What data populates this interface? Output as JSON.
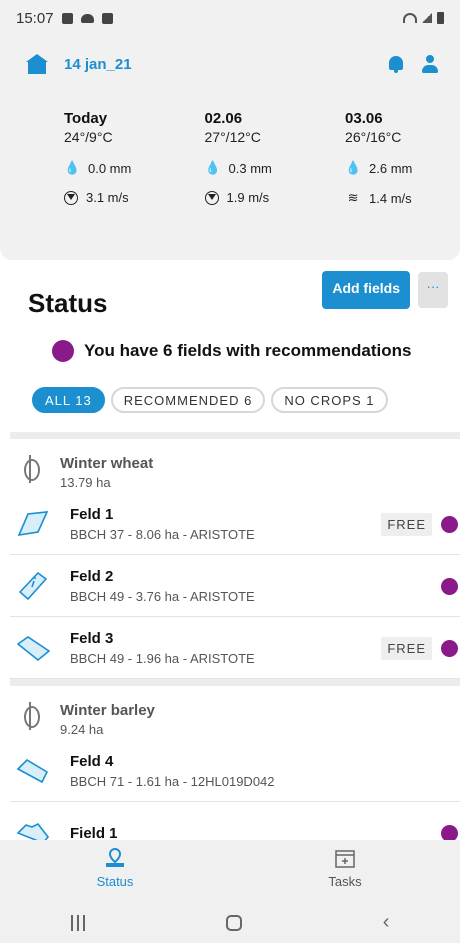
{
  "status_bar": {
    "time": "15:07"
  },
  "header": {
    "farm_name": "14 jan_21"
  },
  "weather": [
    {
      "day": "Today",
      "temp": "24°/9°C",
      "rain": "0.0 mm",
      "wind": "3.1 m/s",
      "wind_icon": "wind-direction-icon"
    },
    {
      "day": "02.06",
      "temp": "27°/12°C",
      "rain": "0.3 mm",
      "wind": "1.9 m/s",
      "wind_icon": "wind-direction-icon"
    },
    {
      "day": "03.06",
      "temp": "26°/16°C",
      "rain": "2.6 mm",
      "wind": "1.4 m/s",
      "wind_icon": "wind-gusts-icon"
    }
  ],
  "status": {
    "title": "Status",
    "add_fields_label": "Add fields",
    "more_label": "···",
    "recommendation_text": "You have 6 fields with recommendations"
  },
  "filters": [
    {
      "label": "ALL 13",
      "active": true
    },
    {
      "label": "RECOMMENDED 6",
      "active": false
    },
    {
      "label": "NO CROPS 1",
      "active": false
    }
  ],
  "groups": [
    {
      "crop": "Winter wheat",
      "area": "13.79 ha",
      "fields": [
        {
          "name": "Feld 1",
          "desc": "BBCH 37 - 8.06 ha - ARISTOTE",
          "badge": "FREE",
          "recommendation": true
        },
        {
          "name": "Feld 2",
          "desc": "BBCH 49 - 3.76 ha - ARISTOTE",
          "badge": "",
          "recommendation": true
        },
        {
          "name": "Feld 3",
          "desc": "BBCH 49 - 1.96 ha - ARISTOTE",
          "badge": "FREE",
          "recommendation": true
        }
      ]
    },
    {
      "crop": "Winter barley",
      "area": "9.24 ha",
      "fields": [
        {
          "name": "Feld 4",
          "desc": "BBCH 71 - 1.61 ha - 12HL019D042",
          "badge": "",
          "recommendation": false
        },
        {
          "name": "Field 1",
          "desc": "",
          "badge": "",
          "recommendation": true
        }
      ]
    }
  ],
  "bottom_nav": [
    {
      "label": "Status",
      "active": true
    },
    {
      "label": "Tasks",
      "active": false
    }
  ],
  "colors": {
    "accent": "#1b8fd0",
    "recommendation": "#8a1a8a"
  }
}
